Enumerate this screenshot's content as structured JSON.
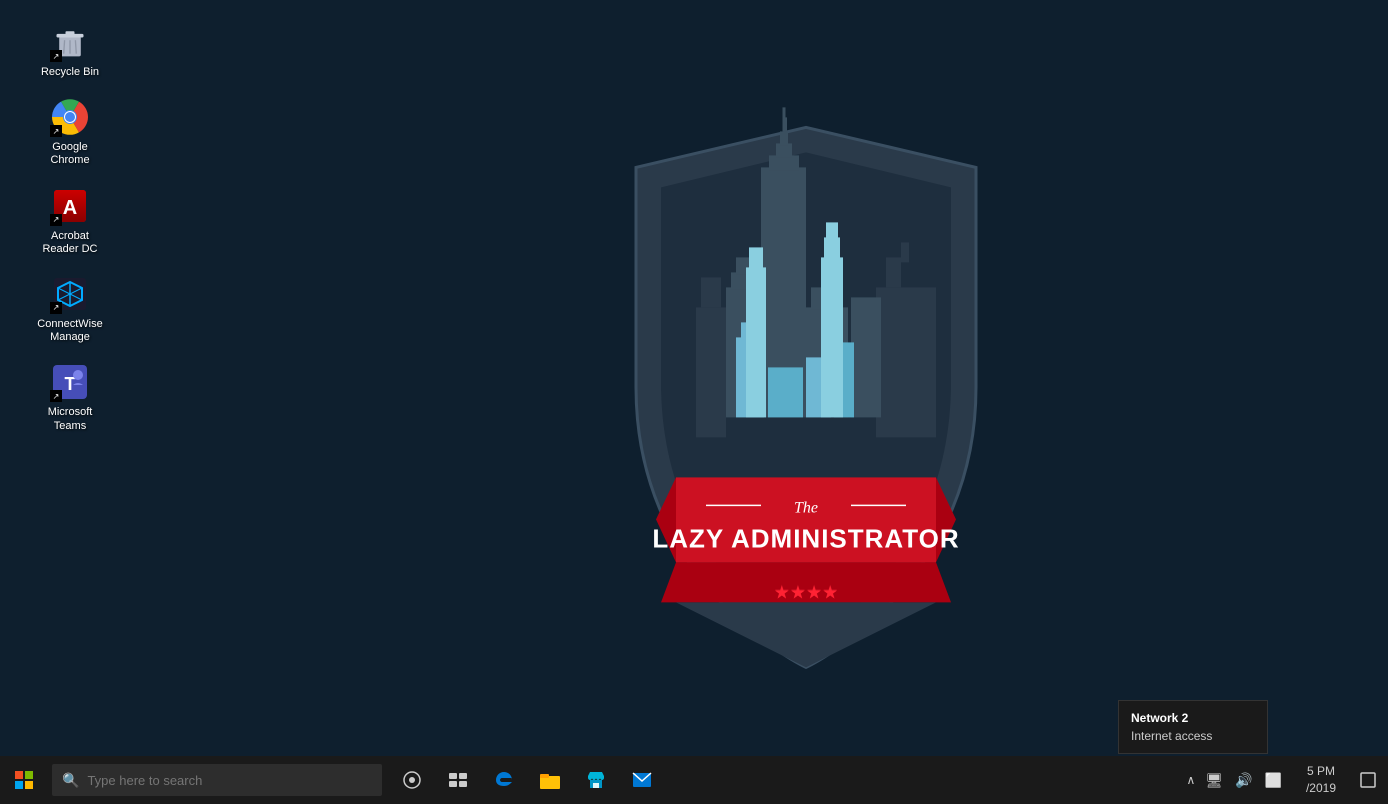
{
  "desktop": {
    "background_color": "#0e1f2e"
  },
  "icons": [
    {
      "id": "recycle-bin",
      "label": "Recycle Bin",
      "type": "recycle-bin"
    },
    {
      "id": "google-chrome",
      "label": "Google Chrome",
      "type": "chrome"
    },
    {
      "id": "acrobat-reader",
      "label": "Acrobat Reader DC",
      "type": "acrobat"
    },
    {
      "id": "connectwise",
      "label": "ConnectWise Manage",
      "type": "connectwise"
    },
    {
      "id": "microsoft-teams",
      "label": "Microsoft Teams",
      "type": "teams"
    }
  ],
  "taskbar": {
    "search_placeholder": "Type here to search",
    "clock": {
      "time": "5 PM",
      "date": "/2019"
    },
    "network": {
      "name": "Network 2",
      "status": "Internet access"
    }
  },
  "logo": {
    "subtitle": "The",
    "title": "LAZY ADMINISTRATOR",
    "stars": "★★★★"
  }
}
